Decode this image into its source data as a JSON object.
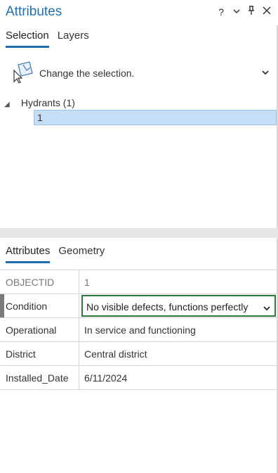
{
  "header": {
    "title": "Attributes",
    "help_glyph": "?",
    "accent_color": "#1f6fb2"
  },
  "top_tabs": [
    {
      "label": "Selection",
      "active": true
    },
    {
      "label": "Layers",
      "active": false
    }
  ],
  "change_selection": {
    "label": "Change the selection.",
    "icon": "change-selection-icon"
  },
  "tree": {
    "layer_label": "Hydrants (1)",
    "feature_label": "1"
  },
  "detail_tabs": [
    {
      "label": "Attributes",
      "active": true
    },
    {
      "label": "Geometry",
      "active": false
    }
  ],
  "fields": [
    {
      "name": "OBJECTID",
      "value": "1",
      "readonly": true
    },
    {
      "name": "Condition",
      "value": "No visible defects, functions perfectly",
      "editing": true
    },
    {
      "name": "Operational",
      "value": "In service and functioning"
    },
    {
      "name": "District",
      "value": "Central district"
    },
    {
      "name": "Installed_Date",
      "value": "6/11/2024"
    }
  ],
  "colors": {
    "selected_row": "#c6def5",
    "edit_border": "#2d7a3a"
  }
}
